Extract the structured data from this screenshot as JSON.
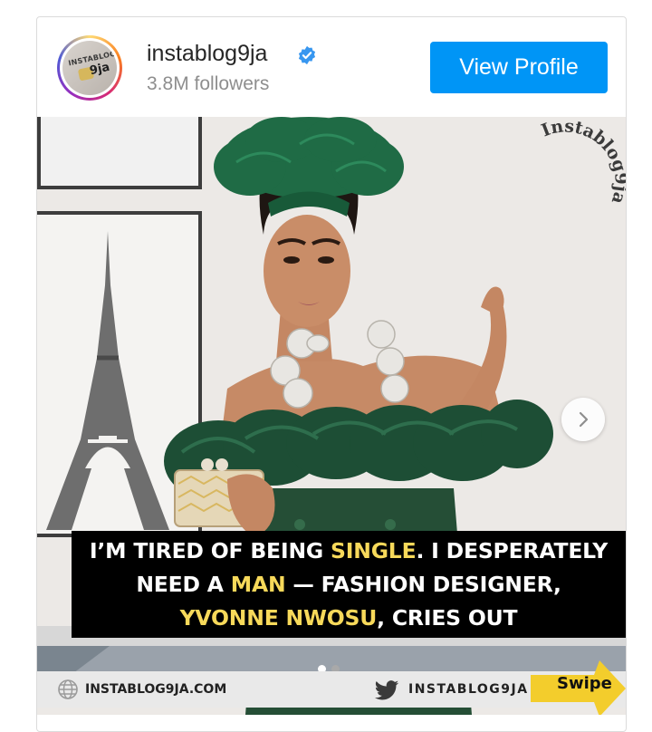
{
  "profile": {
    "username": "instablog9ja",
    "followers": "3.8M followers",
    "view_button": "View Profile",
    "avatar_word": "INSTABLOG",
    "avatar_9ja": "9ja"
  },
  "post": {
    "watermark": "Instablog9ja",
    "caption": {
      "line1_a": "I’M TIRED OF BEING ",
      "line1_b": "SINGLE",
      "line1_c": ". I DESPERATELY",
      "line2_a": "NEED A ",
      "line2_b": "MAN",
      "line2_c": " — FASHION DESIGNER,",
      "line3_a": "YVONNE NWOSU",
      "line3_b": ", CRIES OUT"
    },
    "footer": {
      "site": "INSTABLOG9JA.COM",
      "handle": "INSTABLOG9JA",
      "swipe": "Swipe"
    },
    "carousel": {
      "total": 2,
      "active": 1
    }
  },
  "colors": {
    "accent": "#0095f6",
    "highlight": "#f7d95a",
    "headwrap": "#1f6b45",
    "dress": "#1d4e35"
  }
}
